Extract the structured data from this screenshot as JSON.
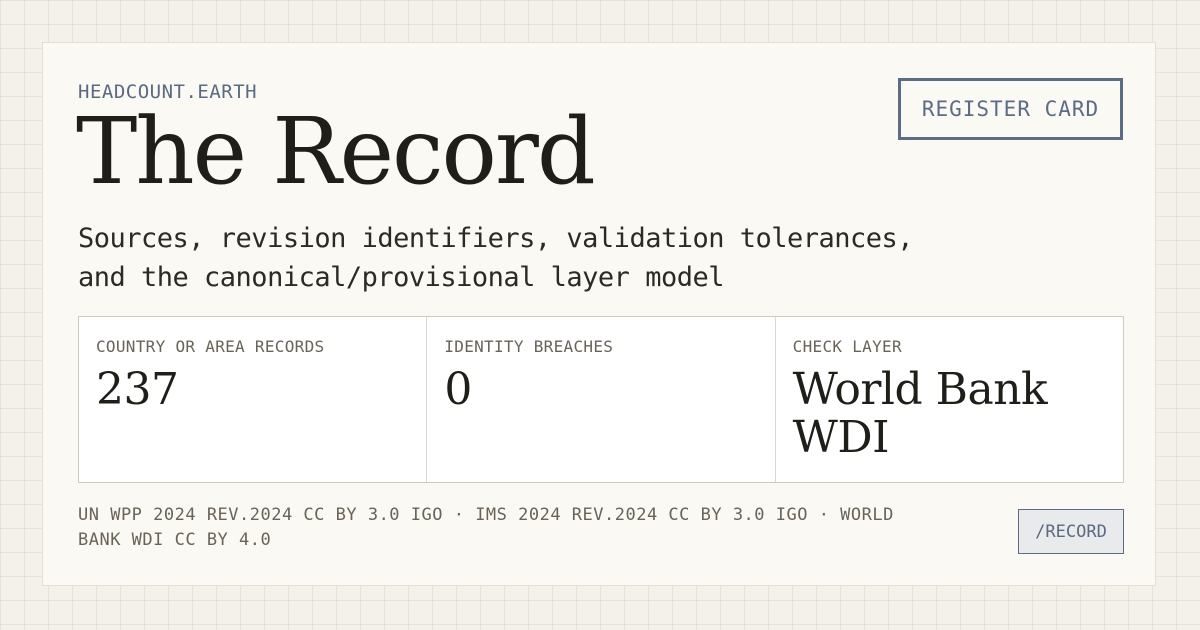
{
  "header": {
    "site_name": "HEADCOUNT.EARTH",
    "register_label": "REGISTER CARD"
  },
  "page": {
    "title": "The Record",
    "description": "Sources, revision identifiers, validation tolerances, and the canonical/provisional layer model"
  },
  "stats": [
    {
      "label": "COUNTRY OR AREA RECORDS",
      "value": "237"
    },
    {
      "label": "IDENTITY BREACHES",
      "value": "0"
    },
    {
      "label": "CHECK LAYER",
      "value": "World Bank WDI"
    }
  ],
  "footer": {
    "sources": "UN WPP 2024 REV.2024 CC BY 3.0 IGO · IMS 2024 REV.2024 CC BY 3.0 IGO · WORLD BANK WDI CC BY 4.0",
    "path": "/RECORD"
  },
  "colors": {
    "accent": "#5c6c85",
    "background": "#f3f1ea",
    "card": "#faf9f4"
  }
}
